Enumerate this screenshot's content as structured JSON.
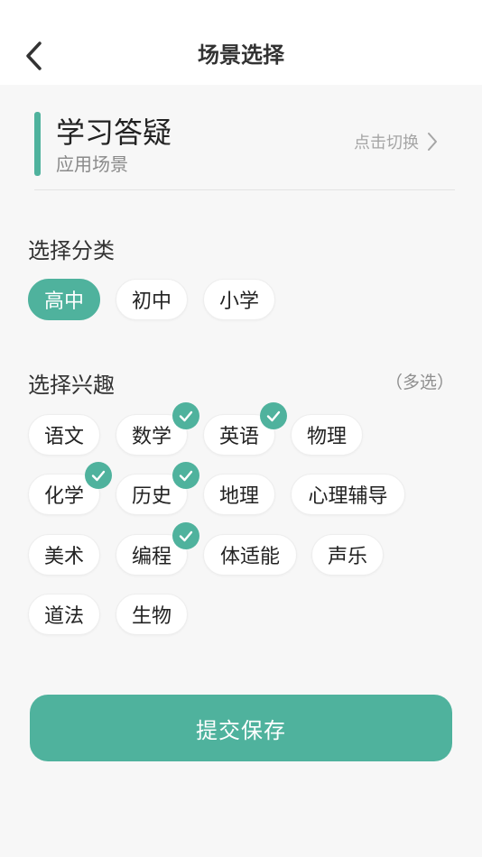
{
  "header": {
    "title": "场景选择",
    "back_icon": "chevron-left-icon"
  },
  "scene": {
    "title": "学习答疑",
    "subtitle": "应用场景",
    "switch_label": "点击切换",
    "accent_color": "#4fb29d"
  },
  "category": {
    "title": "选择分类",
    "options": [
      {
        "label": "高中",
        "selected": true
      },
      {
        "label": "初中",
        "selected": false
      },
      {
        "label": "小学",
        "selected": false
      }
    ]
  },
  "interests": {
    "title": "选择兴趣",
    "hint": "（多选）",
    "options": [
      {
        "label": "语文",
        "selected": false
      },
      {
        "label": "数学",
        "selected": true
      },
      {
        "label": "英语",
        "selected": true
      },
      {
        "label": "物理",
        "selected": false
      },
      {
        "label": "化学",
        "selected": true
      },
      {
        "label": "历史",
        "selected": true
      },
      {
        "label": "地理",
        "selected": false
      },
      {
        "label": "心理辅导",
        "selected": false
      },
      {
        "label": "美术",
        "selected": false
      },
      {
        "label": "编程",
        "selected": true
      },
      {
        "label": "体适能",
        "selected": false
      },
      {
        "label": "声乐",
        "selected": false
      },
      {
        "label": "道法",
        "selected": false
      },
      {
        "label": "生物",
        "selected": false
      }
    ]
  },
  "actions": {
    "save_label": "提交保存"
  }
}
